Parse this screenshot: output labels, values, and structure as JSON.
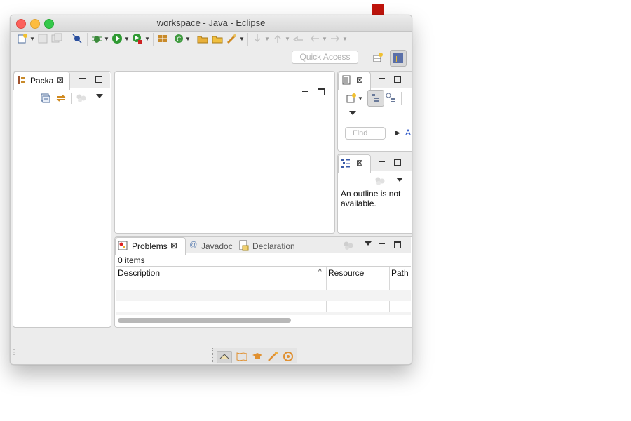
{
  "window": {
    "title": "workspace - Java - Eclipse"
  },
  "toolbar": {
    "quick_access_placeholder": "Quick Access",
    "icons": [
      "new-icon",
      "save-icon",
      "save-all-icon",
      "skip-breakpoints-icon",
      "debug-icon",
      "run-icon",
      "run-external-icon",
      "new-java-package-icon",
      "new-class-icon",
      "open-type-icon",
      "open-task-icon",
      "search-icon",
      "next-annotation-icon",
      "previous-annotation-icon",
      "last-edit-icon",
      "back-icon",
      "forward-icon"
    ],
    "perspectives": [
      "open-perspective-icon",
      "java-perspective-icon"
    ]
  },
  "package_explorer": {
    "tab_label": "Packa"
  },
  "task_list": {
    "find_placeholder": "Find",
    "all_link": "A"
  },
  "outline": {
    "message": "An outline is not available."
  },
  "bottom_panel": {
    "tabs": [
      {
        "label": "Problems",
        "active": true
      },
      {
        "label": "Javadoc",
        "active": false
      },
      {
        "label": "Declaration",
        "active": false
      }
    ],
    "item_count": "0 items",
    "columns": [
      "Description",
      "Resource",
      "Path"
    ]
  },
  "colors": {
    "accent_arrow": "#c0140c",
    "close_red": "#fc605b",
    "minimize_yellow": "#fdbc40",
    "zoom_green": "#34c84a"
  }
}
